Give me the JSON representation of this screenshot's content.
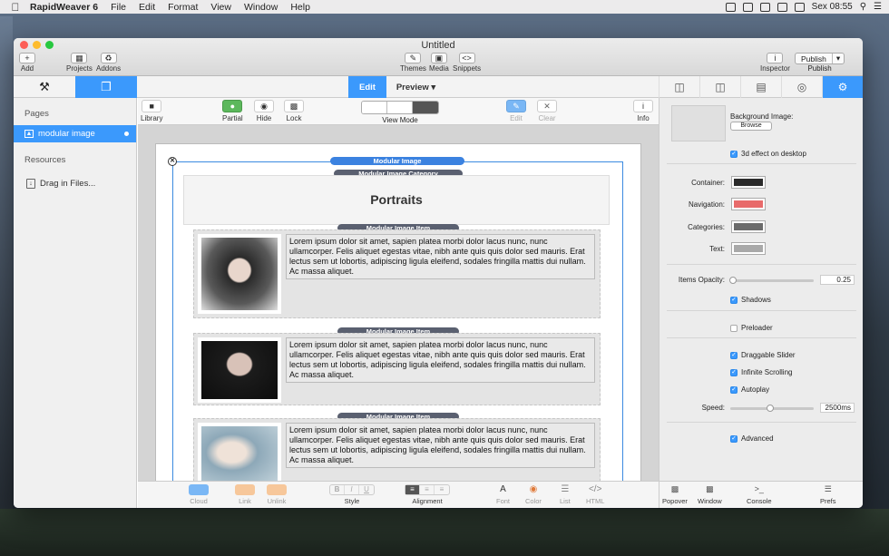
{
  "menubar": {
    "app_name": "RapidWeaver 6",
    "items": [
      "File",
      "Edit",
      "Format",
      "View",
      "Window",
      "Help"
    ],
    "clock": "Sex 08:55"
  },
  "window": {
    "title": "Untitled",
    "toolbar": {
      "add": "Add",
      "projects": "Projects",
      "addons": "Addons",
      "themes": "Themes",
      "media": "Media",
      "snippets": "Snippets",
      "inspector": "Inspector",
      "publish_button": "Publish",
      "publish": "Publish"
    }
  },
  "modes": {
    "edit": "Edit",
    "preview": "Preview ▾"
  },
  "sidebar": {
    "pages_header": "Pages",
    "page_item": "modular image",
    "resources_header": "Resources",
    "drag_files": "Drag in Files..."
  },
  "page_toolbar": {
    "library": "Library",
    "partial": "Partial",
    "hide": "Hide",
    "lock": "Lock",
    "view_mode": "View Mode",
    "edit": "Edit",
    "clear": "Clear",
    "info": "Info"
  },
  "content": {
    "modular_image": "Modular Image",
    "category_label": "Modular Image Category",
    "category_title": "Portraits",
    "item_label": "Modular Image Item",
    "items": [
      {
        "text": "Lorem ipsum dolor sit amet, sapien platea morbi dolor lacus nunc, nunc ullamcorper. Felis aliquet egestas vitae, nibh ante quis quis dolor sed mauris. Erat lectus sem ut lobortis, adipiscing ligula eleifend, sodales fringilla mattis dui nullam. Ac massa aliquet."
      },
      {
        "text": "Lorem ipsum dolor sit amet, sapien platea morbi dolor lacus nunc, nunc ullamcorper. Felis aliquet egestas vitae, nibh ante quis quis dolor sed mauris. Erat lectus sem ut lobortis, adipiscing ligula eleifend, sodales fringilla mattis dui nullam. Ac massa aliquet."
      },
      {
        "text": "Lorem ipsum dolor sit amet, sapien platea morbi dolor lacus nunc, nunc ullamcorper. Felis aliquet egestas vitae, nibh ante quis quis dolor sed mauris. Erat lectus sem ut lobortis, adipiscing ligula eleifend, sodales fringilla mattis dui nullam. Ac massa aliquet."
      }
    ]
  },
  "bottom_toolbar": {
    "cloud": "Cloud",
    "link": "Link",
    "unlink": "Unlink",
    "style": "Style",
    "alignment": "Alignment",
    "font": "Font",
    "color": "Color",
    "list": "List",
    "html": "HTML",
    "bold": "B",
    "italic": "I",
    "underline": "U"
  },
  "inspector": {
    "background_image": "Background Image:",
    "browse": "Browse",
    "effect_3d": "3d effect on desktop",
    "container": "Container:",
    "navigation": "Navigation:",
    "categories": "Categories:",
    "text": "Text:",
    "colors": {
      "container": "#2b2b2b",
      "navigation": "#e86a6a",
      "categories": "#6b6b6b",
      "text": "#a9a9a9"
    },
    "items_opacity": "Items Opacity:",
    "opacity_value": "0.25",
    "shadows": "Shadows",
    "preloader": "Preloader",
    "draggable_slider": "Draggable Slider",
    "infinite_scrolling": "Infinite Scrolling",
    "autoplay": "Autoplay",
    "speed": "Speed:",
    "speed_value": "2500ms",
    "advanced": "Advanced"
  },
  "inspector_bottom": {
    "popover": "Popover",
    "window": "Window",
    "console": "Console",
    "prefs": "Prefs"
  }
}
